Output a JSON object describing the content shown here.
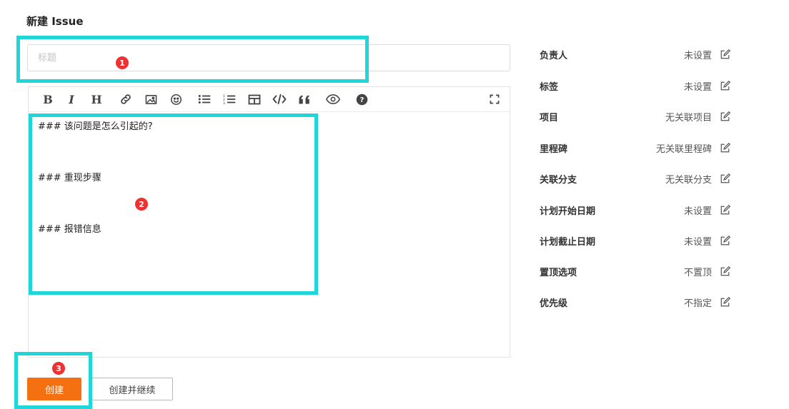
{
  "page": {
    "title": "新建 Issue"
  },
  "title_field": {
    "placeholder": "标题",
    "value": ""
  },
  "editor": {
    "toolbar": [
      {
        "name": "bold",
        "glyph": "B"
      },
      {
        "name": "italic",
        "glyph": "I"
      },
      {
        "name": "heading",
        "glyph": "H"
      },
      {
        "name": "link"
      },
      {
        "name": "image"
      },
      {
        "name": "emoji"
      },
      {
        "name": "bullet-list"
      },
      {
        "name": "ordered-list"
      },
      {
        "name": "table"
      },
      {
        "name": "code"
      },
      {
        "name": "quote"
      },
      {
        "name": "preview"
      },
      {
        "name": "help"
      },
      {
        "name": "fullscreen"
      }
    ],
    "lines": [
      "### 该问题是怎么引起的?",
      "",
      "",
      "",
      "### 重现步骤",
      "",
      "",
      "",
      "### 报错信息"
    ]
  },
  "sidebar": [
    {
      "label": "负责人",
      "value": "未设置"
    },
    {
      "label": "标签",
      "value": "未设置"
    },
    {
      "label": "项目",
      "value": "无关联项目"
    },
    {
      "label": "里程碑",
      "value": "无关联里程碑"
    },
    {
      "label": "关联分支",
      "value": "无关联分支"
    },
    {
      "label": "计划开始日期",
      "value": "未设置"
    },
    {
      "label": "计划截止日期",
      "value": "未设置"
    },
    {
      "label": "置顶选项",
      "value": "不置顶"
    },
    {
      "label": "优先级",
      "value": "不指定"
    }
  ],
  "actions": {
    "create": "创建",
    "create_continue": "创建并继续"
  },
  "annotations": {
    "marker_1": "1",
    "marker_2": "2",
    "marker_3": "3",
    "highlight_color": "#1fd7d8",
    "marker_color": "#ef3131"
  },
  "colors": {
    "primary": "#f57010"
  }
}
